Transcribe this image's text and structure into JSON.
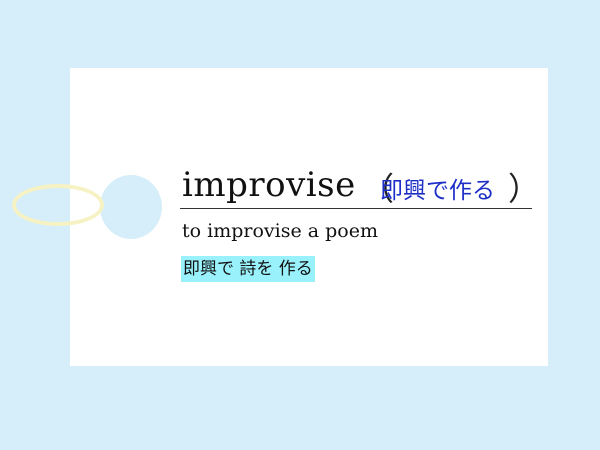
{
  "card": {
    "headword": "improvise",
    "paren_open": "（",
    "gloss_ja": "即興で作る",
    "paren_close": "）",
    "example_en": "to improvise a poem",
    "example_ja": "即興で 詩を 作る"
  },
  "colors": {
    "background": "#d6eef9",
    "card": "#ffffff",
    "gloss_text": "#1e2fc8",
    "highlight": "#99f1fb",
    "string": "#f7f2c4"
  }
}
